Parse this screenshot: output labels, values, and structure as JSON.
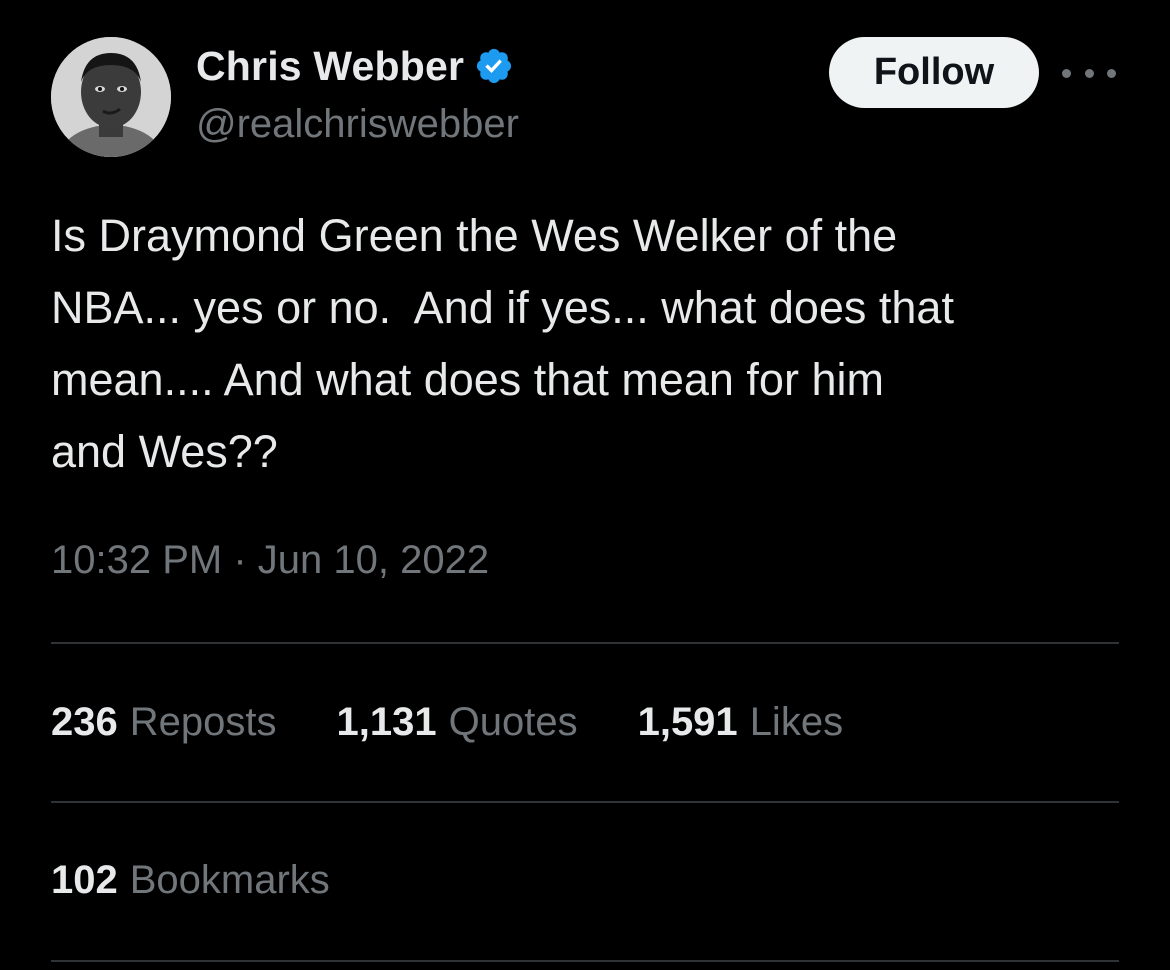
{
  "author": {
    "display_name": "Chris Webber",
    "handle": "@realchriswebber",
    "verified": true
  },
  "follow_label": "Follow",
  "tweet": {
    "text": "Is Draymond Green the Wes Welker of the\nNBA... yes or no.  And if yes... what does that\nmean.... And what does that mean for him\nand Wes??",
    "timestamp": "10:32 PM · Jun 10, 2022"
  },
  "stats": {
    "reposts": {
      "count": "236",
      "label": "Reposts"
    },
    "quotes": {
      "count": "1,131",
      "label": "Quotes"
    },
    "likes": {
      "count": "1,591",
      "label": "Likes"
    },
    "bookmarks": {
      "count": "102",
      "label": "Bookmarks"
    }
  },
  "icons": {
    "verified": "verified-badge-icon",
    "more": "more-options-icon"
  },
  "colors": {
    "background": "#000000",
    "primary_text": "#e7e9ea",
    "secondary_text": "#71767b",
    "verified_blue": "#1d9bf0",
    "divider": "#2f3336",
    "follow_button_bg": "#eff3f4"
  }
}
